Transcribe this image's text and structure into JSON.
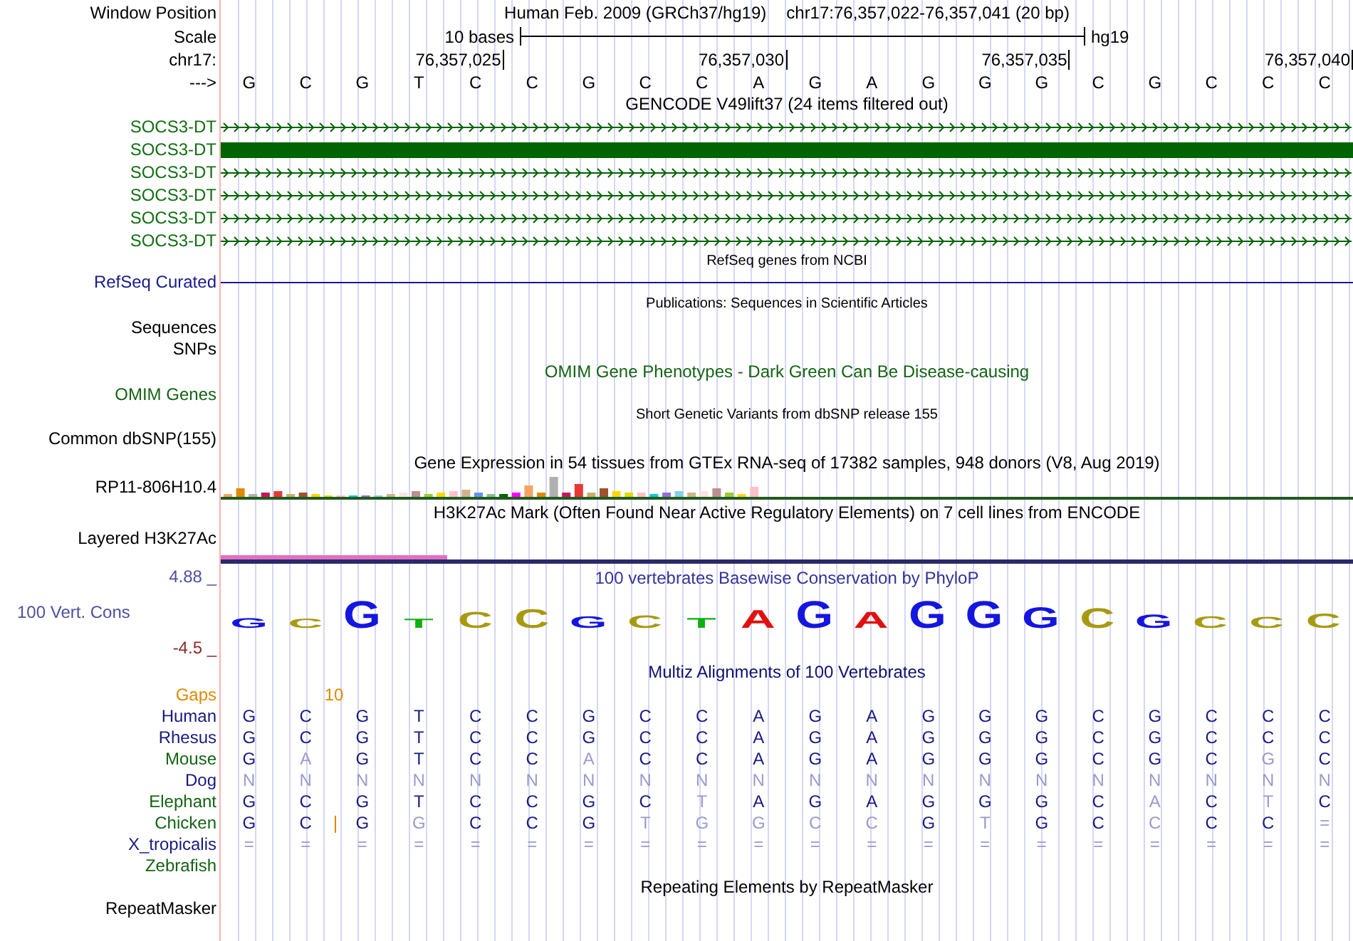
{
  "header": {
    "window_position_label": "Window Position",
    "position_text": "Human Feb. 2009 (GRCh37/hg19)",
    "region": "chr17:76,357,022-76,357,041 (20 bp)",
    "scale_label": "Scale",
    "scale_text": "10 bases",
    "assembly": "hg19",
    "chrom_label": "chr17:",
    "ticks": [
      "76,357,025",
      "76,357,030",
      "76,357,035",
      "76,357,040"
    ],
    "strand_label": "--->",
    "bases": [
      "G",
      "C",
      "G",
      "T",
      "C",
      "C",
      "G",
      "C",
      "C",
      "A",
      "G",
      "A",
      "G",
      "G",
      "G",
      "C",
      "G",
      "C",
      "C",
      "C"
    ]
  },
  "gencode": {
    "title": "GENCODE V49lift37 (24 items filtered out)",
    "transcripts": [
      {
        "label": "SOCS3-DT",
        "kind": "arrows"
      },
      {
        "label": "SOCS3-DT",
        "kind": "block"
      },
      {
        "label": "SOCS3-DT",
        "kind": "arrows"
      },
      {
        "label": "SOCS3-DT",
        "kind": "arrows"
      },
      {
        "label": "SOCS3-DT",
        "kind": "arrows"
      },
      {
        "label": "SOCS3-DT",
        "kind": "arrows"
      }
    ]
  },
  "refseq": {
    "title": "RefSeq genes from NCBI",
    "label": "RefSeq Curated"
  },
  "publications": {
    "title": "Publications: Sequences in Scientific Articles",
    "labels": [
      "Sequences",
      "SNPs"
    ]
  },
  "omim": {
    "title": "OMIM Gene Phenotypes - Dark Green Can Be Disease-causing",
    "label": "OMIM Genes"
  },
  "dbsnp": {
    "title": "Short Genetic Variants from dbSNP release 155",
    "label": "Common dbSNP(155)"
  },
  "gtex": {
    "title": "Gene Expression in 54 tissues from GTEx RNA-seq of 17382 samples, 948 donors (V8, Aug 2019)",
    "label": "RP11-806H10.4"
  },
  "h3k27ac": {
    "title": "H3K27Ac Mark (Often Found Near Active Regulatory Elements) on 7 cell lines from ENCODE",
    "label": "Layered H3K27Ac"
  },
  "phylop": {
    "title": "100 vertebrates Basewise Conservation by PhyloP",
    "label": "100 Vert. Cons",
    "y_max": "4.88 _",
    "y_min": "-4.5 _",
    "logo": [
      {
        "base": "G"
      },
      {
        "base": "C"
      },
      {
        "base": "G"
      },
      {
        "base": "T"
      },
      {
        "base": "C"
      },
      {
        "base": "C"
      },
      {
        "base": "G"
      },
      {
        "base": "C"
      },
      {
        "base": "T"
      },
      {
        "base": "A"
      },
      {
        "base": "G"
      },
      {
        "base": "A"
      },
      {
        "base": "G"
      },
      {
        "base": "G"
      },
      {
        "base": "G"
      },
      {
        "base": "C"
      },
      {
        "base": "G"
      },
      {
        "base": "C"
      },
      {
        "base": "C"
      },
      {
        "base": "C"
      }
    ]
  },
  "multiz": {
    "title": "Multiz Alignments of 100 Vertebrates",
    "gaps_label": "Gaps",
    "gap_count": "10",
    "species": [
      {
        "name": "Human",
        "color": "#1a1a80",
        "gap": false,
        "bases": [
          "G",
          "C",
          "G",
          "T",
          "C",
          "C",
          "G",
          "C",
          "C",
          "A",
          "G",
          "A",
          "G",
          "G",
          "G",
          "C",
          "G",
          "C",
          "C",
          "C"
        ]
      },
      {
        "name": "Rhesus",
        "color": "#1a1a80",
        "gap": false,
        "bases": [
          "G",
          "C",
          "G",
          "T",
          "C",
          "C",
          "G",
          "C",
          "C",
          "A",
          "G",
          "A",
          "G",
          "G",
          "G",
          "C",
          "G",
          "C",
          "C",
          "C"
        ]
      },
      {
        "name": "Mouse",
        "color": "#146414",
        "gap": false,
        "bases": [
          "G",
          "A",
          "G",
          "T",
          "C",
          "C",
          "A",
          "C",
          "C",
          "A",
          "G",
          "A",
          "G",
          "G",
          "G",
          "C",
          "G",
          "C",
          "G",
          "C"
        ]
      },
      {
        "name": "Dog",
        "color": "#1a1a80",
        "gap": false,
        "bases": [
          "N",
          "N",
          "N",
          "N",
          "N",
          "N",
          "N",
          "N",
          "N",
          "N",
          "N",
          "N",
          "N",
          "N",
          "N",
          "N",
          "N",
          "N",
          "N",
          "N"
        ]
      },
      {
        "name": "Elephant",
        "color": "#146414",
        "gap": false,
        "bases": [
          "G",
          "C",
          "G",
          "T",
          "C",
          "C",
          "G",
          "C",
          "T",
          "A",
          "G",
          "A",
          "G",
          "G",
          "G",
          "C",
          "A",
          "C",
          "T",
          "C"
        ]
      },
      {
        "name": "Chicken",
        "color": "#146414",
        "gap": true,
        "bases": [
          "G",
          "C",
          "G",
          "G",
          "C",
          "C",
          "G",
          "T",
          "G",
          "G",
          "C",
          "C",
          "G",
          "T",
          "G",
          "C",
          "C",
          "C",
          "C",
          "="
        ]
      },
      {
        "name": "X_tropicalis",
        "color": "#1a1a80",
        "gap": false,
        "bases": [
          "=",
          "=",
          "=",
          "=",
          "=",
          "=",
          "=",
          "=",
          "=",
          "=",
          "=",
          "=",
          "=",
          "=",
          "=",
          "=",
          "=",
          "=",
          "=",
          "="
        ]
      },
      {
        "name": "Zebrafish",
        "color": "#146414",
        "gap": false
      }
    ]
  },
  "repeatmasker": {
    "title": "Repeating Elements by RepeatMasker",
    "label": "RepeatMasker"
  }
}
